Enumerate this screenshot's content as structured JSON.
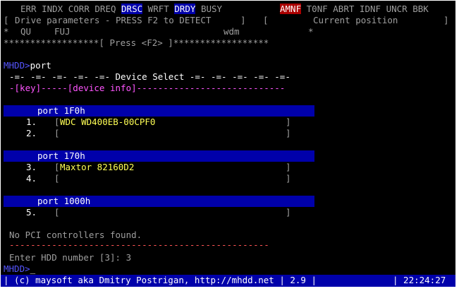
{
  "status_flags": {
    "err": "ERR",
    "indx": "INDX",
    "corr": "CORR",
    "dreq": "DREQ",
    "drsc": "DRSC",
    "wrft": "WRFT",
    "drdy": "DRDY",
    "busy": "BUSY",
    "amnf": "AMNF",
    "t0nf": "T0NF",
    "abrt": "ABRT",
    "idnf": "IDNF",
    "unc": "UNCR",
    "bbk": "BBK"
  },
  "drive_params": {
    "lbracket": "[",
    "label": "Drive parameters - PRESS F2 to DETECT",
    "rbracket": "]",
    "pos_open": "[",
    "position_label": "Current position",
    "pos_close": "]",
    "star": "*",
    "model": "QU",
    "serial": "FUJ",
    "name": "wdm",
    "star_end": "*",
    "press_line": "******************[ Press <F2> ]******************"
  },
  "command": {
    "prompt": "MHDD>",
    "text": "port"
  },
  "device_select": {
    "title_line": "-=- -=- -=- -=- -=- Device Select -=- -=- -=- -=- -=-",
    "header_line": "-[key]-----[device info]----------------------------"
  },
  "groups": [
    {
      "port": "port 1F0h",
      "rows": [
        {
          "key": "1.",
          "open": "[",
          "device": "WDC WD400EB-00CPF0",
          "close": "]"
        },
        {
          "key": "2.",
          "open": "[",
          "device": "",
          "close": "]"
        }
      ]
    },
    {
      "port": "port 170h",
      "rows": [
        {
          "key": "3.",
          "open": "[",
          "device": "Maxtor 82160D2",
          "close": "]"
        },
        {
          "key": "4.",
          "open": "[",
          "device": "",
          "close": "]"
        }
      ]
    },
    {
      "port": "port 1000h",
      "rows": [
        {
          "key": "5.",
          "open": "[",
          "device": "",
          "close": "]"
        }
      ]
    }
  ],
  "messages": {
    "no_pci": "No PCI controllers found.",
    "divider": "-------------------------------------------------",
    "enter_label": "Enter HDD number [3]:",
    "enter_value": "3",
    "prompt2": "MHDD>",
    "cursor": "_"
  },
  "status_bar": {
    "copyright": "| (c) maysoft aka Dmitry Postrigan, http://mhdd.net | 2.9 |",
    "clock": "| 22:24:27"
  },
  "colors": {
    "background": "#000000",
    "highlight_blue": "#0000aa",
    "active_flag_red": "#aa0000",
    "device_yellow": "#ffff55",
    "header_magenta": "#ff55ff",
    "prompt_blue": "#5555ff"
  }
}
